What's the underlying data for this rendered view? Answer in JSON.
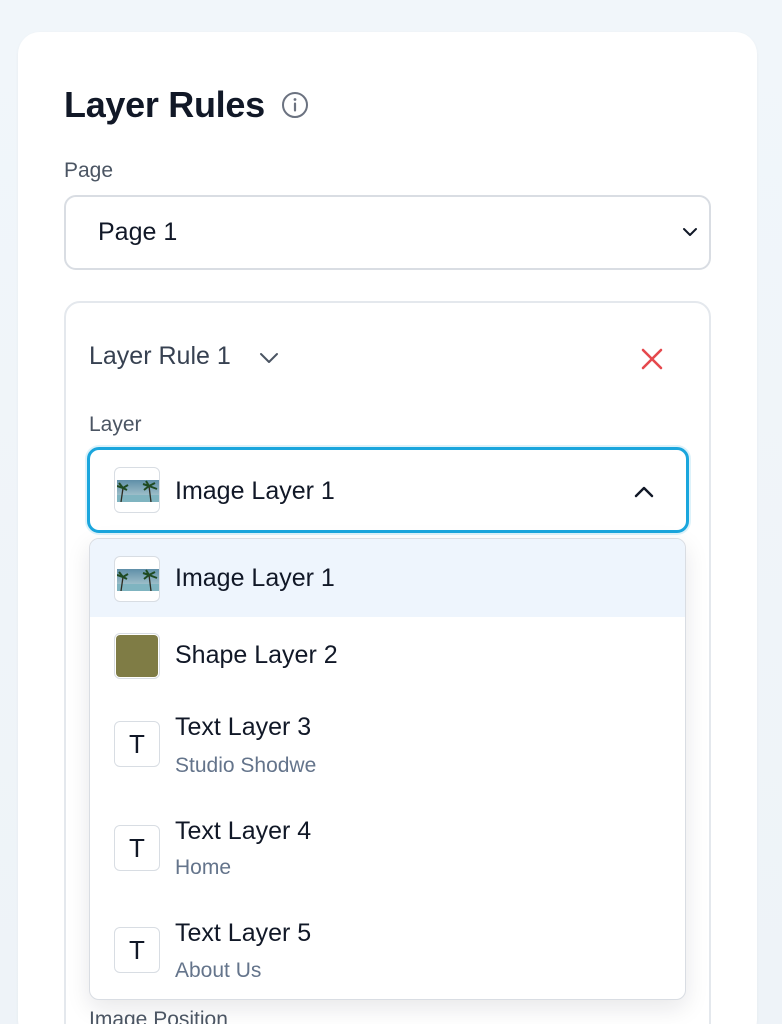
{
  "header": {
    "title": "Layer Rules",
    "info_icon": "info-circle-icon"
  },
  "page_field": {
    "label": "Page",
    "selected": "Page 1",
    "icon": "chevron-down-icon"
  },
  "rule": {
    "title": "Layer Rule 1",
    "collapse_icon": "chevron-down-icon",
    "remove_icon": "close-icon",
    "remove_color": "#e5484d",
    "layer_label": "Layer",
    "selected_layer": "Image Layer 1",
    "open_icon": "chevron-up-icon",
    "focus_color": "#1aa6dd"
  },
  "layer_options": [
    {
      "label": "Image Layer 1",
      "sub": "",
      "kind": "image",
      "selected": true
    },
    {
      "label": "Shape Layer 2",
      "sub": "",
      "kind": "shape",
      "swatch_color": "#7f7c45"
    },
    {
      "label": "Text Layer 3",
      "sub": "Studio Shodwe",
      "kind": "text",
      "glyph": "T"
    },
    {
      "label": "Text Layer 4",
      "sub": "Home",
      "kind": "text",
      "glyph": "T"
    },
    {
      "label": "Text Layer 5",
      "sub": "About Us",
      "kind": "text",
      "glyph": "T"
    }
  ],
  "next_section": {
    "label": "Image Position"
  }
}
